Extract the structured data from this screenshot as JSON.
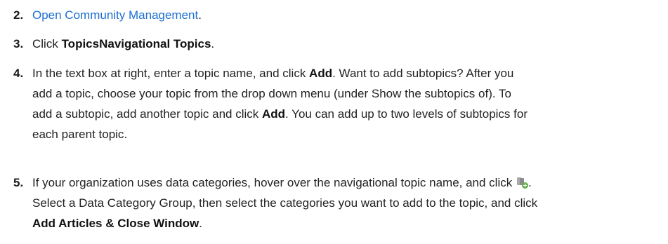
{
  "steps": [
    {
      "number": "2.",
      "link_text": "Open Community Management",
      "after_link": "."
    },
    {
      "number": "3.",
      "prefix": "Click ",
      "bold": "TopicsNavigational Topics",
      "suffix": "."
    },
    {
      "number": "4.",
      "lines": [
        {
          "pre": "In the text box at right, enter a topic name, and click ",
          "bold": "Add",
          "post": ". Want to add subtopics? After you"
        },
        {
          "text": "add a topic, choose your topic from the drop down menu (under Show the subtopics of). To"
        },
        {
          "pre": "add a subtopic, add another topic and click ",
          "bold": "Add",
          "post": ". You can add up to two levels of subtopics for"
        },
        {
          "text": "each parent topic."
        }
      ]
    },
    {
      "number": "5.",
      "lines": [
        {
          "pre": "If your organization uses data categories, hover over the navigational topic name, and click ",
          "icon": "add-articles-icon",
          "post": "."
        },
        {
          "text": "Select a Data Category Group, then select the categories you want to add to the topic, and click"
        },
        {
          "bold": "Add Articles & Close Window",
          "post": "."
        }
      ]
    }
  ]
}
